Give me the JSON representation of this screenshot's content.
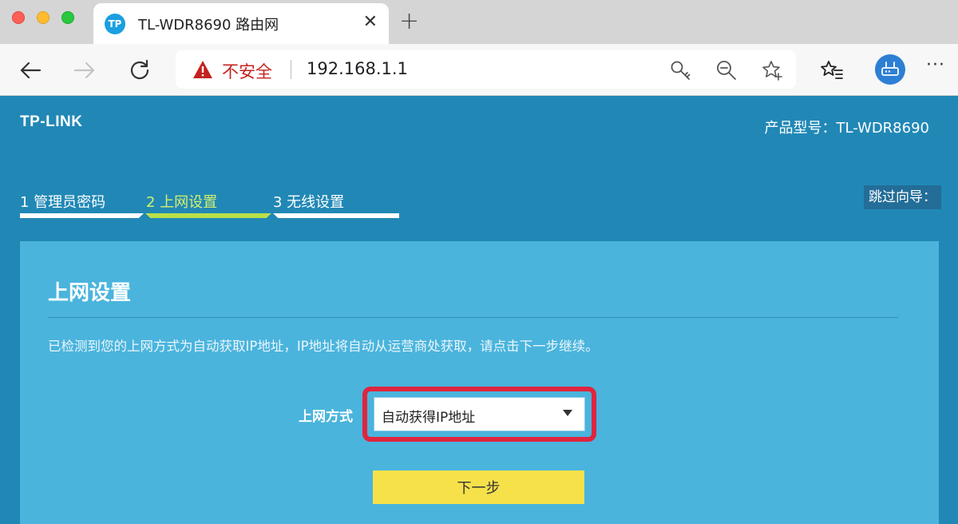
{
  "browser": {
    "tab": {
      "favicon_text": "TP",
      "title": "TL-WDR8690 路由网"
    },
    "address_bar": {
      "security_label": "不安全",
      "url": "192.168.1.1"
    },
    "colors": {
      "insecure": "#c5221f",
      "profile": "#2d7fd4"
    },
    "icons": [
      "back-icon",
      "forward-icon",
      "reload-icon",
      "warning-icon",
      "key-icon",
      "zoom-out-icon",
      "star-add-icon",
      "favorites-icon",
      "profile-icon",
      "more-icon",
      "close-icon",
      "plus-icon"
    ]
  },
  "router": {
    "logo": "TP-LINK",
    "model": "产品型号：TL-WDR8690",
    "steps": [
      {
        "label": "1 管理员密码",
        "active": false
      },
      {
        "label": "2 上网设置",
        "active": true
      },
      {
        "label": "3 无线设置",
        "active": false
      }
    ],
    "skip": "跳过向导：",
    "panel": {
      "title": "上网设置",
      "description": "已检测到您的上网方式为自动获取IP地址，IP地址将自动从运营商处获取，请点击下一步继续。",
      "field_label": "上网方式",
      "select_value": "自动获得IP地址",
      "next_button": "下一步"
    },
    "colors": {
      "background": "#2188b6",
      "panel": "#4ab4dd",
      "active_step": "#d5f06d",
      "highlight": "#e0253e",
      "button": "#f6e14b"
    }
  }
}
